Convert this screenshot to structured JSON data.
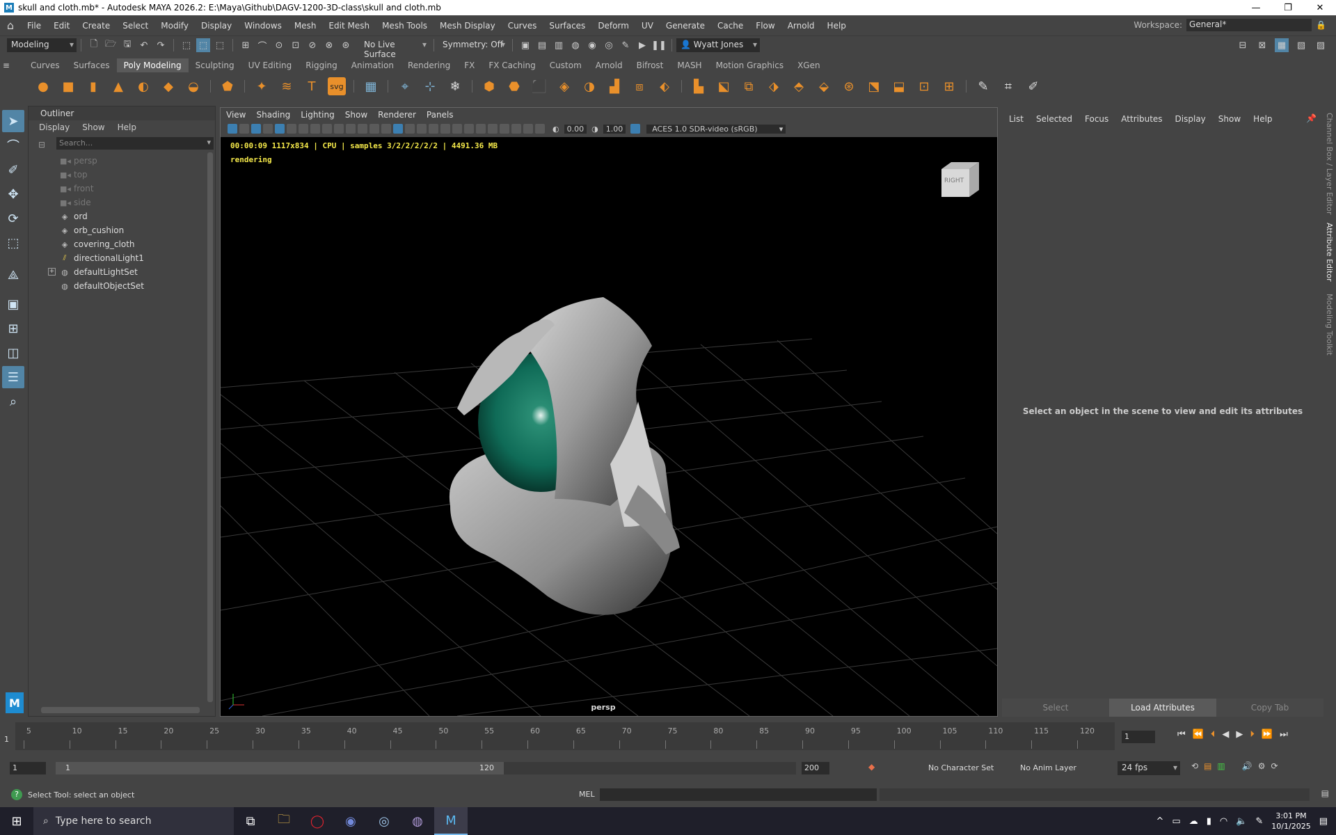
{
  "window": {
    "title": "skull and cloth.mb* - Autodesk MAYA 2026.2: E:\\Maya\\Github\\DAGV-1200-3D-class\\skull and cloth.mb"
  },
  "menubar": {
    "items": [
      "File",
      "Edit",
      "Create",
      "Select",
      "Modify",
      "Display",
      "Windows",
      "Mesh",
      "Edit Mesh",
      "Mesh Tools",
      "Mesh Display",
      "Curves",
      "Surfaces",
      "Deform",
      "UV",
      "Generate",
      "Cache",
      "Flow",
      "Arnold",
      "Help"
    ],
    "workspace_label": "Workspace:",
    "workspace_value": "General*"
  },
  "statusline": {
    "menuset": "Modeling",
    "live_surface": "No Live Surface",
    "symmetry": "Symmetry: Off",
    "user": "Wyatt Jones"
  },
  "shelf": {
    "tabs": [
      "Curves",
      "Surfaces",
      "Poly Modeling",
      "Sculpting",
      "UV Editing",
      "Rigging",
      "Animation",
      "Rendering",
      "FX",
      "FX Caching",
      "Custom",
      "Arnold",
      "Bifrost",
      "MASH",
      "Motion Graphics",
      "XGen"
    ],
    "active_tab": "Poly Modeling"
  },
  "outliner": {
    "title": "Outliner",
    "menu": [
      "Display",
      "Show",
      "Help"
    ],
    "search_placeholder": "Search...",
    "items": [
      {
        "label": "persp",
        "icon": "camera-icon",
        "dim": true
      },
      {
        "label": "top",
        "icon": "camera-icon",
        "dim": true
      },
      {
        "label": "front",
        "icon": "camera-icon",
        "dim": true
      },
      {
        "label": "side",
        "icon": "camera-icon",
        "dim": true
      },
      {
        "label": "ord",
        "icon": "mesh-icon",
        "dim": false
      },
      {
        "label": "orb_cushion",
        "icon": "mesh-icon",
        "dim": false
      },
      {
        "label": "covering_cloth",
        "icon": "mesh-icon",
        "dim": false
      },
      {
        "label": "directionalLight1",
        "icon": "light-icon",
        "dim": false
      },
      {
        "label": "defaultLightSet",
        "icon": "set-icon",
        "dim": false,
        "expandable": true
      },
      {
        "label": "defaultObjectSet",
        "icon": "set-icon",
        "dim": false
      }
    ]
  },
  "viewport": {
    "menu": [
      "View",
      "Shading",
      "Lighting",
      "Show",
      "Renderer",
      "Panels"
    ],
    "exposure": "0.00",
    "gamma": "1.00",
    "color_space": "ACES 1.0 SDR-video (sRGB)",
    "hud_line": "00:00:09 1117x834 | CPU | samples 3/2/2/2/2/2 | 4491.36 MB",
    "hud_status": "rendering",
    "camera_label": "persp",
    "viewcube_face": "RIGHT",
    "orb_color": "#0f6b57"
  },
  "attribute_editor": {
    "menu": [
      "List",
      "Selected",
      "Focus",
      "Attributes",
      "Display",
      "Show",
      "Help"
    ],
    "message": "Select an object in the scene to view and edit its attributes",
    "footer": [
      "Select",
      "Load Attributes",
      "Copy Tab"
    ],
    "side_tabs": [
      "Channel Box / Layer Editor",
      "Attribute Editor",
      "Modeling Toolkit"
    ]
  },
  "timeslider": {
    "ticks": [
      "5",
      "10",
      "15",
      "20",
      "25",
      "30",
      "35",
      "40",
      "45",
      "50",
      "55",
      "60",
      "65",
      "70",
      "75",
      "80",
      "85",
      "90",
      "95",
      "100",
      "105",
      "110",
      "115",
      "120"
    ],
    "current_frame_marker": "1",
    "current_frame": "1"
  },
  "rangebar": {
    "start": "1",
    "range_start": "1",
    "range_end": "120",
    "end": "200",
    "character_set": "No Character Set",
    "anim_layer": "No Anim Layer",
    "fps": "24 fps"
  },
  "cmdline": {
    "help_text": "Select Tool: select an object",
    "mel_label": "MEL"
  },
  "taskbar": {
    "search_placeholder": "Type here to search",
    "time": "3:01 PM",
    "date": "10/1/2025"
  }
}
